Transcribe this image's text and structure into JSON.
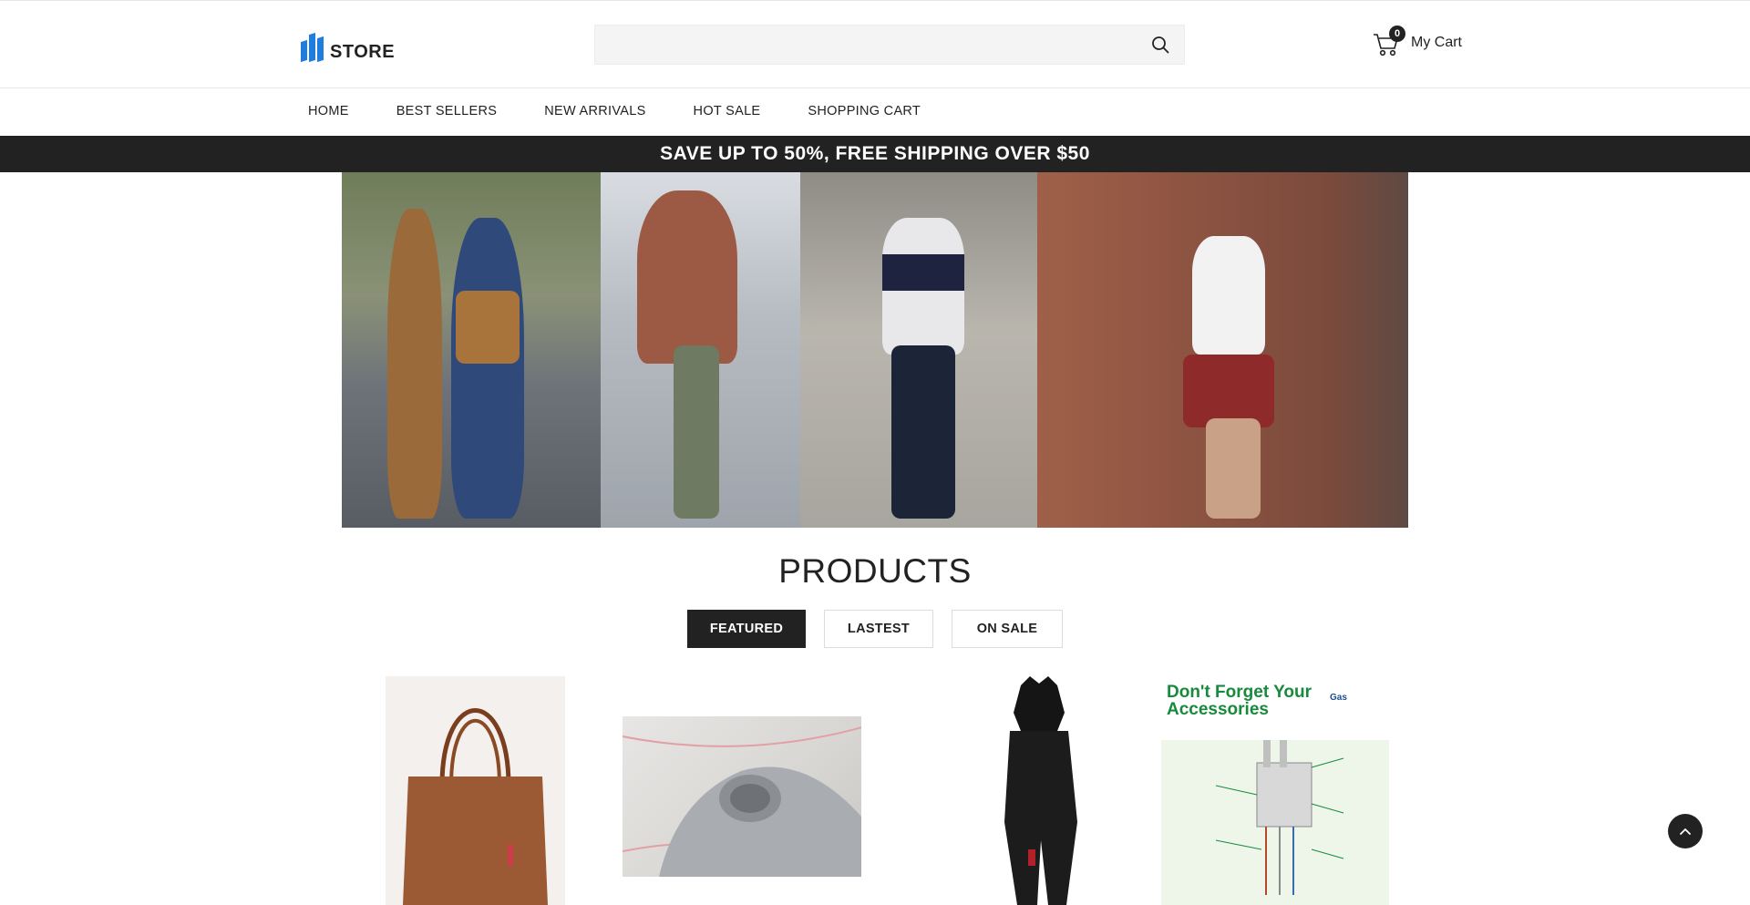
{
  "header": {
    "logo_text": "STORE",
    "search": {
      "placeholder": "",
      "value": ""
    },
    "cart": {
      "count": "0",
      "label": "My Cart"
    }
  },
  "nav": {
    "items": [
      {
        "label": "HOME"
      },
      {
        "label": "BEST SELLERS"
      },
      {
        "label": "NEW ARRIVALS"
      },
      {
        "label": "HOT SALE"
      },
      {
        "label": "SHOPPING CART"
      }
    ]
  },
  "promo": {
    "text": "SAVE UP TO 50%, FREE SHIPPING OVER $50"
  },
  "products_section": {
    "title": "PRODUCTS",
    "tabs": [
      {
        "label": "FEATURED",
        "active": true
      },
      {
        "label": "LASTEST",
        "active": false
      },
      {
        "label": "ON SALE",
        "active": false
      }
    ]
  },
  "products": {
    "accessories_banner_title": "Don't Forget Your Accessories",
    "accessories_badge": "Gas"
  },
  "colors": {
    "accent": "#1f7de0",
    "dark": "#222222",
    "accessory_green": "#178a3c"
  }
}
